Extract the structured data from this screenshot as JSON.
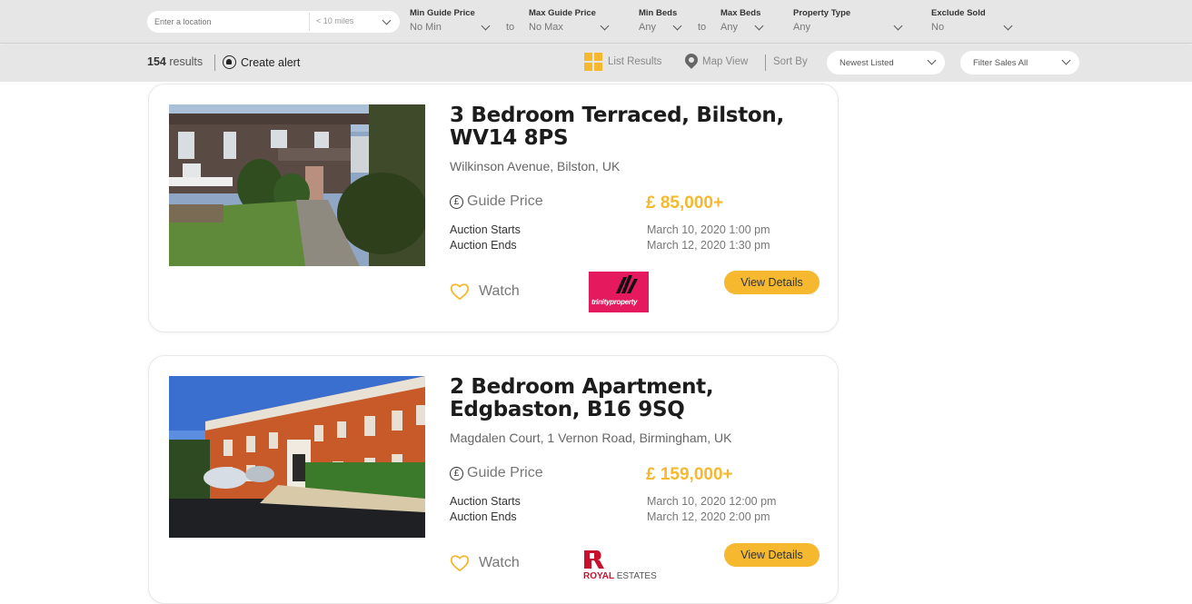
{
  "filters": {
    "location_placeholder": "Enter a location",
    "radius": "< 10 miles",
    "min_guide_price": {
      "label": "Min Guide Price",
      "value": "No Min"
    },
    "max_guide_price": {
      "label": "Max Guide Price",
      "value": "No Max"
    },
    "min_beds": {
      "label": "Min Beds",
      "value": "Any"
    },
    "max_beds": {
      "label": "Max Beds",
      "value": "Any"
    },
    "property_type": {
      "label": "Property Type",
      "value": "Any"
    },
    "exclude_sold": {
      "label": "Exclude Sold",
      "value": "No"
    },
    "to_label": "to"
  },
  "toolbar": {
    "results_count": "154",
    "results_label": "results",
    "create_alert": "Create alert",
    "list_results": "List Results",
    "map_view": "Map View",
    "sort_by": "Sort By",
    "sort_value": "Newest Listed",
    "filter_value": "Filter Sales All"
  },
  "listings": [
    {
      "title": "3 Bedroom Terraced, Bilston, WV14 8PS",
      "address": "Wilkinson Avenue, Bilston, UK",
      "guide_label": "Guide Price",
      "price": "£ 85,000+",
      "starts_label": "Auction Starts",
      "starts": "March 10, 2020 1:00 pm",
      "ends_label": "Auction Ends",
      "ends": "March 12, 2020 1:30 pm",
      "watch": "Watch",
      "button": "View Details",
      "agent_logo_text": "trinityproperty"
    },
    {
      "title": "2 Bedroom Apartment, Edgbaston, B16 9SQ",
      "address": "Magdalen Court, 1 Vernon Road, Birmingham, UK",
      "guide_label": "Guide Price",
      "price": "£ 159,000+",
      "starts_label": "Auction Starts",
      "starts": "March 10, 2020 12:00 pm",
      "ends_label": "Auction Ends",
      "ends": "March 12, 2020 2:00 pm",
      "watch": "Watch",
      "button": "View Details",
      "agent_logo_text": "ROYAL ESTATES"
    }
  ],
  "colors": {
    "accent": "#f5b82e",
    "trinity_brand": "#e5195e",
    "royal_brand": "#c8102e"
  }
}
